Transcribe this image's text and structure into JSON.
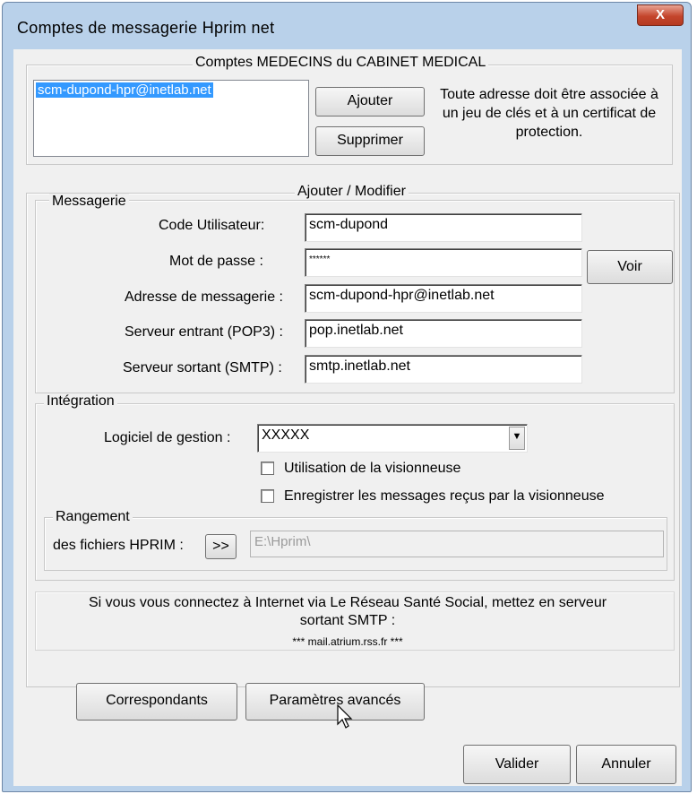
{
  "window": {
    "title": "Comptes de messagerie Hprim net",
    "close_glyph": "X"
  },
  "accounts": {
    "legend": "Comptes MEDECINS du CABINET MEDICAL",
    "items": [
      "scm-dupond-hpr@inetlab.net"
    ],
    "add_label": "Ajouter",
    "delete_label": "Supprimer",
    "note": "Toute adresse doit être associée à un jeu de clés et à un certificat de protection."
  },
  "edit": {
    "legend": "Ajouter / Modifier",
    "messagerie_legend": "Messagerie",
    "user_code": {
      "label": "Code Utilisateur:",
      "value": "scm-dupond"
    },
    "password": {
      "label": "Mot de passe :",
      "value": "******"
    },
    "show_label": "Voir",
    "email": {
      "label": "Adresse de messagerie :",
      "value": "scm-dupond-hpr@inetlab.net"
    },
    "pop3": {
      "label": "Serveur entrant (POP3) :",
      "value": "pop.inetlab.net"
    },
    "smtp": {
      "label": "Serveur sortant (SMTP) :",
      "value": "smtp.inetlab.net"
    }
  },
  "integration": {
    "legend": "Intégration",
    "software": {
      "label": "Logiciel de gestion :",
      "value": "XXXXX"
    },
    "use_viewer": {
      "label": "Utilisation de la visionneuse",
      "checked": false
    },
    "save_messages": {
      "label": "Enregistrer les messages reçus par la visionneuse",
      "checked": false
    },
    "storage": {
      "legend": "Rangement",
      "label": "des fichiers HPRIM :",
      "browse_label": ">>",
      "path": "E:\\Hprim\\"
    }
  },
  "info": {
    "line1": "Si vous vous connectez à Internet via Le Réseau Santé Social, mettez en serveur",
    "line2": "sortant SMTP :",
    "line3": "*** mail.atrium.rss.fr ***"
  },
  "footer": {
    "correspondants_label": "Correspondants",
    "advanced_label": "Paramètres avancés",
    "ok_label": "Valider",
    "cancel_label": "Annuler"
  }
}
